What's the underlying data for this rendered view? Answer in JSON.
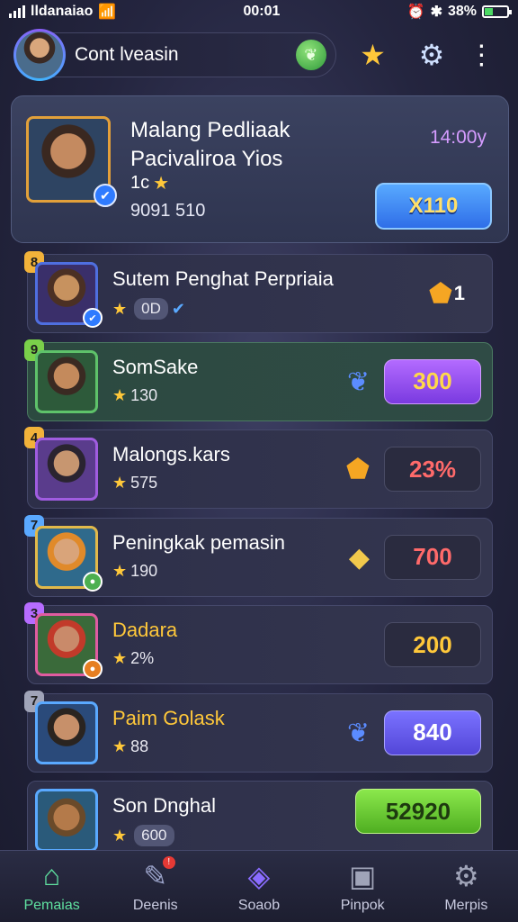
{
  "status_bar": {
    "carrier": "lldanaiao",
    "time": "00:01",
    "battery": "38%"
  },
  "profile": {
    "name": "Cont lveasin"
  },
  "featured": {
    "title": "Malang Pedliaak Pacivaliroa Yios",
    "stars_label": "1c",
    "score": "9091 510",
    "timer": "14:00y",
    "cta_label": "X110"
  },
  "rankings": [
    {
      "rank": "8",
      "name": "Sutem Penghat Perpriaia",
      "sub": "0D",
      "value": "1",
      "icon": "bolt-icon"
    },
    {
      "rank": "9",
      "name": "SomSake",
      "sub": "130",
      "value": "300",
      "icon": "leaf-icon"
    },
    {
      "rank": "4",
      "name": "Malongs.kars",
      "sub": "575",
      "value": "23%",
      "icon": "bolt-icon"
    },
    {
      "rank": "7",
      "name": "Peningkak pemasin",
      "sub": "190",
      "value": "700",
      "icon": "crystal-icon"
    },
    {
      "rank": "3",
      "name": "Dadara",
      "sub": "2%",
      "value": "200",
      "icon": ""
    },
    {
      "rank": "7",
      "name": "Paim Golask",
      "sub": "88",
      "value": "840",
      "icon": "leaf-icon"
    },
    {
      "rank": "",
      "name": "Son Dnghal",
      "sub": "600",
      "value": "52920",
      "icon": ""
    }
  ],
  "nav": [
    {
      "label": "Pemaias",
      "icon": "home-icon"
    },
    {
      "label": "Deenis",
      "icon": "chat-icon"
    },
    {
      "label": "Soaob",
      "icon": "cube-icon"
    },
    {
      "label": "Pinpok",
      "icon": "shop-icon"
    },
    {
      "label": "Merpis",
      "icon": "settings-icon"
    }
  ],
  "colors": {
    "accent": "#5fe0a0",
    "gold": "#ffc83a"
  }
}
